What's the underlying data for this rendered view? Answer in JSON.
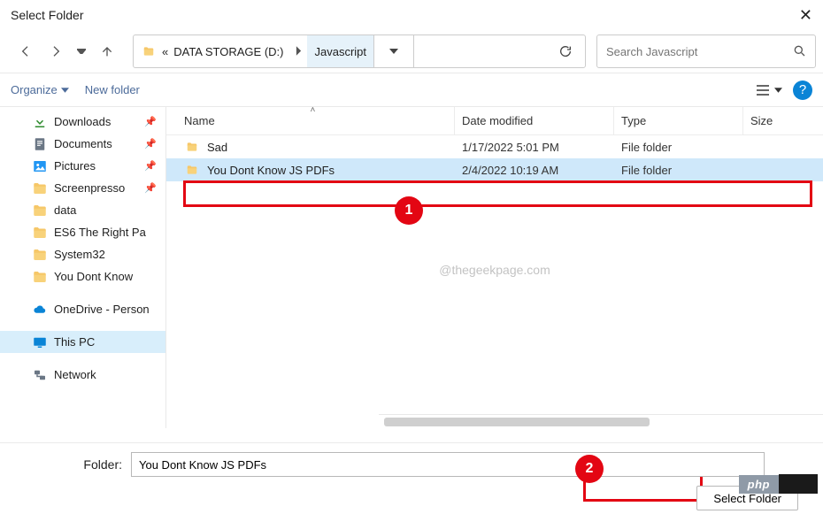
{
  "title": "Select Folder",
  "breadcrumb": {
    "root": "DATA STORAGE (D:)",
    "current": "Javascript"
  },
  "search": {
    "placeholder": "Search Javascript"
  },
  "toolbar": {
    "organize": "Organize",
    "new_folder": "New folder"
  },
  "columns": {
    "name": "Name",
    "date": "Date modified",
    "type": "Type",
    "size": "Size"
  },
  "rows": [
    {
      "name": "Sad",
      "date": "1/17/2022 5:01 PM",
      "type": "File folder"
    },
    {
      "name": "You Dont Know JS PDFs",
      "date": "2/4/2022 10:19 AM",
      "type": "File folder"
    }
  ],
  "sidebar": [
    {
      "label": "Downloads",
      "icon": "download",
      "pinned": true
    },
    {
      "label": "Documents",
      "icon": "doc",
      "pinned": true
    },
    {
      "label": "Pictures",
      "icon": "picture",
      "pinned": true
    },
    {
      "label": "Screenpresso",
      "icon": "folder",
      "pinned": true
    },
    {
      "label": "data",
      "icon": "folder"
    },
    {
      "label": "ES6 The Right Pa",
      "icon": "folder"
    },
    {
      "label": "System32",
      "icon": "folder"
    },
    {
      "label": "You Dont Know",
      "icon": "folder"
    },
    {
      "label": "OneDrive - Person",
      "icon": "onedrive",
      "spaced": true
    },
    {
      "label": "This PC",
      "icon": "pc",
      "spaced": true,
      "selected": true
    },
    {
      "label": "Network",
      "icon": "network",
      "spaced": true
    }
  ],
  "watermark": "@thegeekpage.com",
  "footer": {
    "label": "Folder:",
    "value": "You Dont Know JS PDFs",
    "select_btn": "Select Folder"
  },
  "badges": {
    "one": "1",
    "two": "2"
  },
  "php_tag": "php"
}
